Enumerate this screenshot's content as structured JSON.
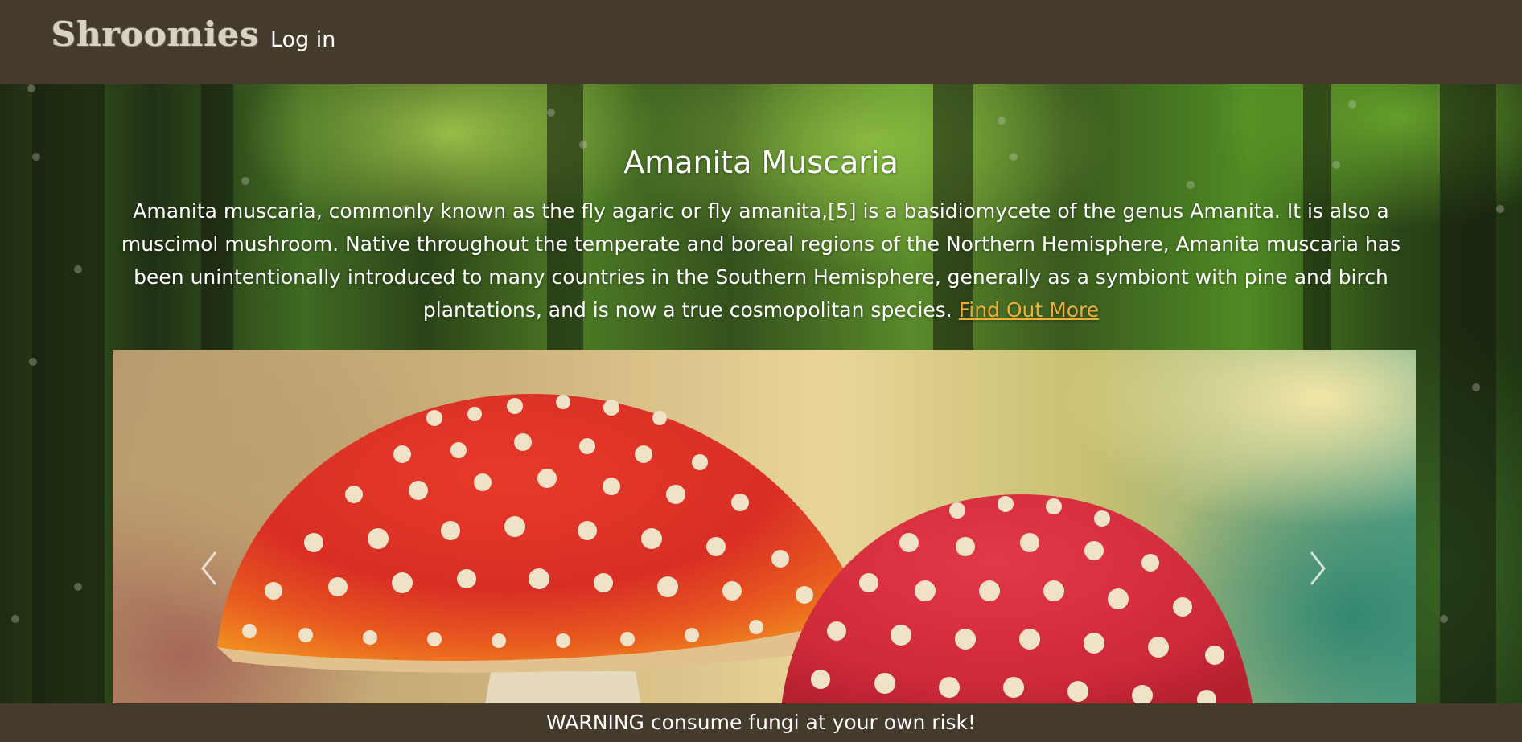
{
  "navbar": {
    "brand": "Shroomies",
    "login_label": "Log in"
  },
  "hero": {
    "title": "Amanita Muscaria",
    "description": "Amanita muscaria, commonly known as the fly agaric or fly amanita,[5] is a basidiomycete of the genus Amanita. It is also a muscimol mushroom. Native throughout the temperate and boreal regions of the Northern Hemisphere, Amanita muscaria has been unintentionally introduced to many countries in the Southern Hemisphere, generally as a symbiont with pine and birch plantations, and is now a true cosmopolitan species.",
    "link_label": "Find Out More"
  },
  "carousel": {
    "prev_icon": "chevron-left-icon",
    "next_icon": "chevron-right-icon",
    "image": "amanita-muscaria-photo"
  },
  "footer": {
    "warning": "WARNING consume fungi at your own risk!"
  },
  "colors": {
    "nav_bg": "#443b2c",
    "link": "#e9b03a",
    "text": "#ffffff"
  }
}
